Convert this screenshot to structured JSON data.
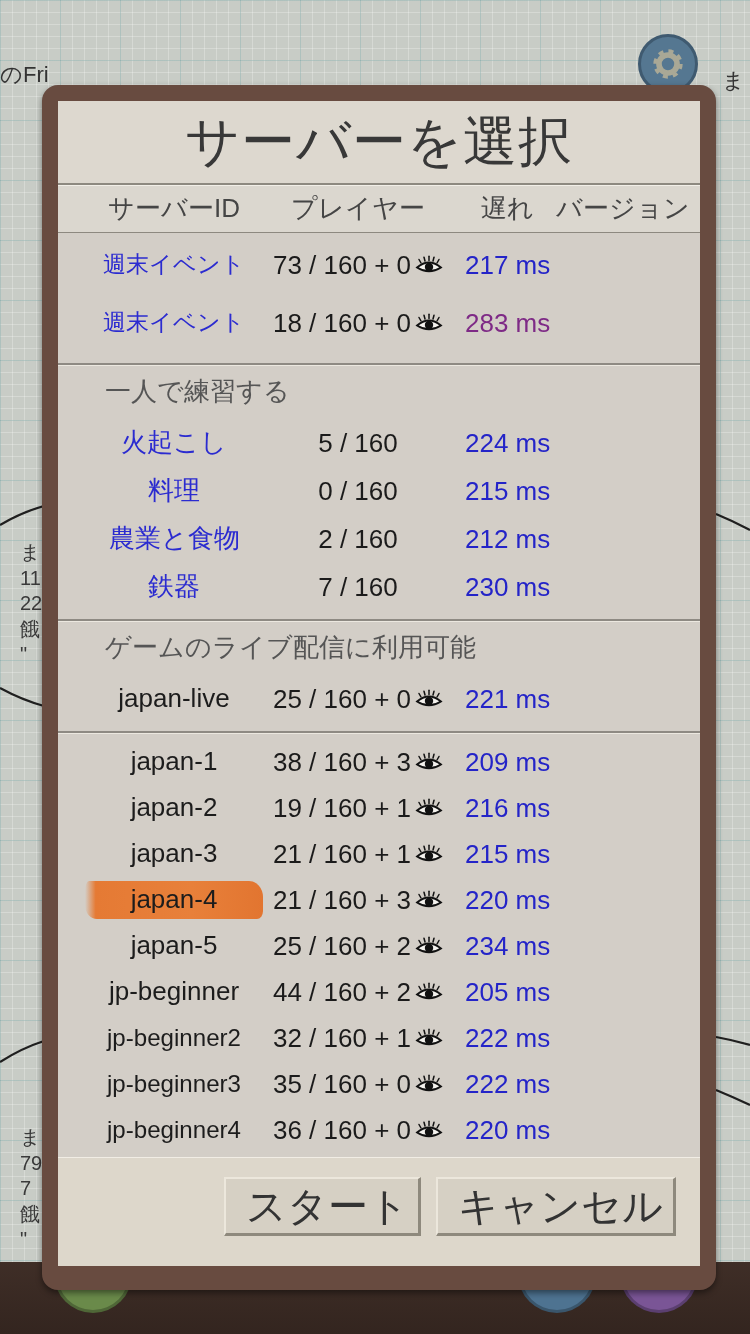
{
  "background": {
    "top_line": "のFri",
    "top_right": "ま",
    "notes": [
      {
        "lines": [
          "ま",
          "11",
          "22",
          "餓",
          "\""
        ]
      },
      {
        "lines": [
          "ま",
          "79",
          "7",
          "餓",
          "\""
        ]
      }
    ]
  },
  "dialog": {
    "title": "サーバーを選択",
    "columns": [
      "サーバーID",
      "プレイヤー",
      "遅れ",
      "バージョン"
    ],
    "sections": [
      {
        "kind": "event",
        "rows": [
          {
            "name": "週末イベント",
            "players": "73 / 160 + 0",
            "watchable": true,
            "ping": {
              "text": "217 ms",
              "color": "#2424c8"
            },
            "selected": false
          },
          {
            "name": "週末イベント",
            "players": "18 / 160 + 0",
            "watchable": true,
            "ping": {
              "text": "283 ms",
              "color": "#7e2a86"
            },
            "selected": false
          }
        ]
      },
      {
        "kind": "practice",
        "heading": "一人で練習する",
        "rows": [
          {
            "name": "火起こし",
            "players": "5 / 160",
            "watchable": false,
            "ping": {
              "text": "224 ms",
              "color": "#2424c8"
            },
            "selected": false
          },
          {
            "name": "料理",
            "players": "0 / 160",
            "watchable": false,
            "ping": {
              "text": "215 ms",
              "color": "#2424c8"
            },
            "selected": false
          },
          {
            "name": "農業と食物",
            "players": "2 / 160",
            "watchable": false,
            "ping": {
              "text": "212 ms",
              "color": "#2424c8"
            },
            "selected": false
          },
          {
            "name": "鉄器",
            "players": "7 / 160",
            "watchable": false,
            "ping": {
              "text": "230 ms",
              "color": "#2424c8"
            },
            "selected": false
          }
        ]
      },
      {
        "kind": "live",
        "heading": "ゲームのライブ配信に利用可能",
        "rows": [
          {
            "name": "japan-live",
            "players": "25 / 160 + 0",
            "watchable": true,
            "ping": {
              "text": "221 ms",
              "color": "#2424c8"
            },
            "selected": false
          }
        ]
      },
      {
        "kind": "standard",
        "rows": [
          {
            "name": "japan-1",
            "players": "38 / 160 + 3",
            "watchable": true,
            "ping": {
              "text": "209 ms",
              "color": "#2424c8"
            },
            "selected": false
          },
          {
            "name": "japan-2",
            "players": "19 / 160 + 1",
            "watchable": true,
            "ping": {
              "text": "216 ms",
              "color": "#2424c8"
            },
            "selected": false
          },
          {
            "name": "japan-3",
            "players": "21 / 160 + 1",
            "watchable": true,
            "ping": {
              "text": "215 ms",
              "color": "#2424c8"
            },
            "selected": false
          },
          {
            "name": "japan-4",
            "players": "21 / 160 + 3",
            "watchable": true,
            "ping": {
              "text": "220 ms",
              "color": "#2424c8"
            },
            "selected": true
          },
          {
            "name": "japan-5",
            "players": "25 / 160 + 2",
            "watchable": true,
            "ping": {
              "text": "234 ms",
              "color": "#2424c8"
            },
            "selected": false
          },
          {
            "name": "jp-beginner",
            "players": "44 / 160 + 2",
            "watchable": true,
            "ping": {
              "text": "205 ms",
              "color": "#2424c8"
            },
            "selected": false
          },
          {
            "name": "jp-beginner2",
            "players": "32 / 160 + 1",
            "watchable": true,
            "ping": {
              "text": "222 ms",
              "color": "#2424c8"
            },
            "selected": false
          },
          {
            "name": "jp-beginner3",
            "players": "35 / 160 + 0",
            "watchable": true,
            "ping": {
              "text": "222 ms",
              "color": "#2424c8"
            },
            "selected": false
          },
          {
            "name": "jp-beginner4",
            "players": "36 / 160 + 0",
            "watchable": true,
            "ping": {
              "text": "220 ms",
              "color": "#2424c8"
            },
            "selected": false
          }
        ]
      }
    ],
    "buttons": [
      "スタート",
      "キャンセル"
    ]
  }
}
